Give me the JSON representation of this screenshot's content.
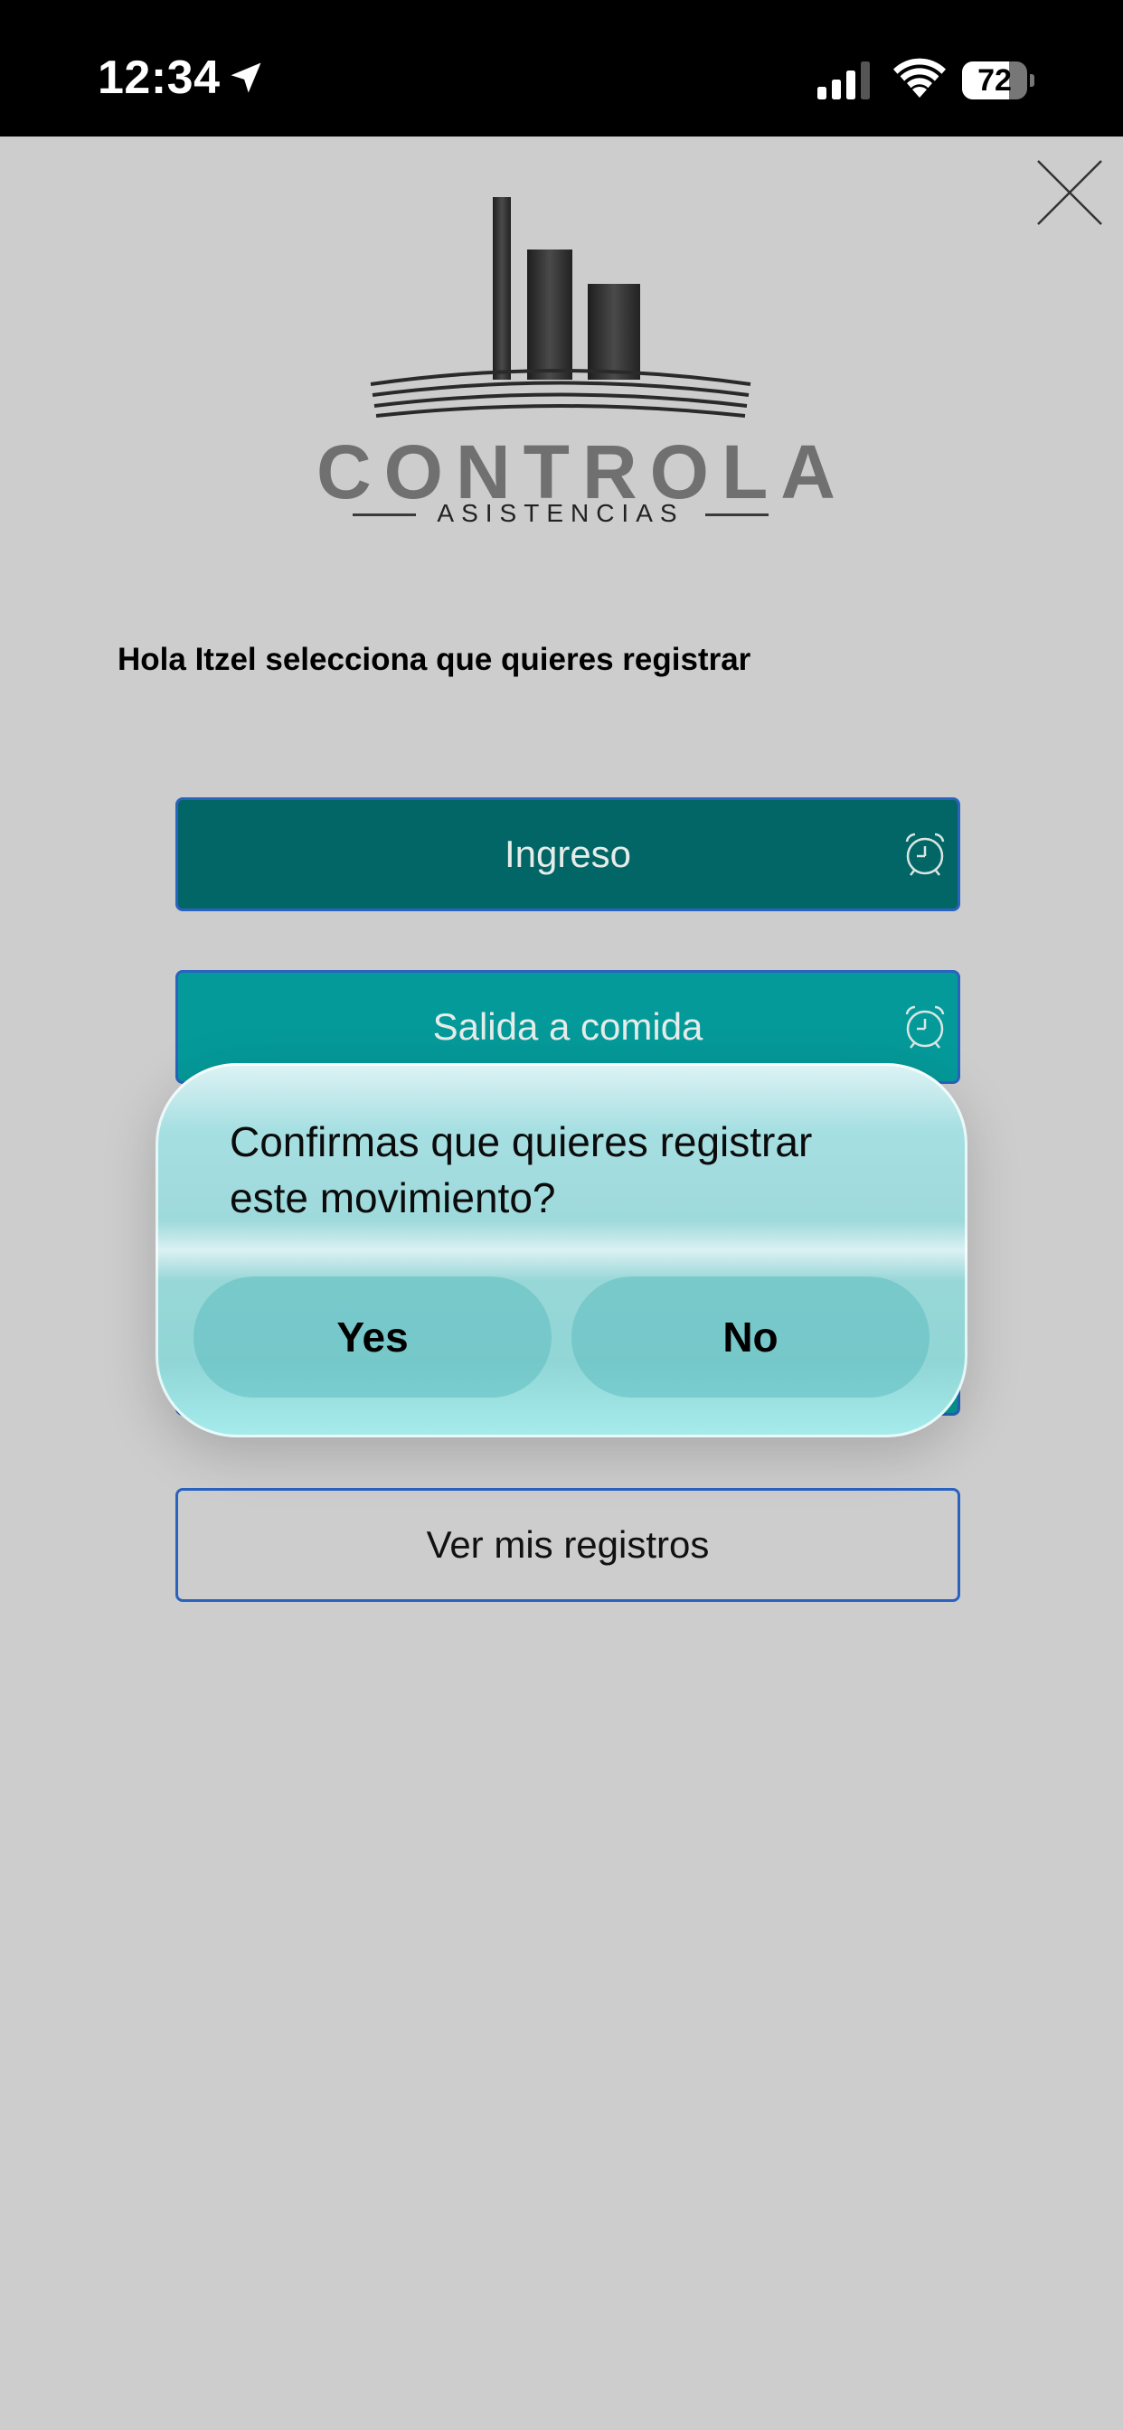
{
  "status_bar": {
    "time": "12:34",
    "battery": "72",
    "battery_level": 0.72,
    "icons": [
      "location-arrow-icon",
      "signal-icon",
      "wifi-icon",
      "battery-icon"
    ]
  },
  "logo": {
    "word": "CONTROLA",
    "sub": "ASISTENCIAS"
  },
  "greeting": "Hola Itzel selecciona que quieres registrar",
  "buttons": {
    "ingreso": "Ingreso",
    "salida": "Salida a comida",
    "ver": "Ver mis registros"
  },
  "dialog": {
    "message": "Confirmas que quieres registrar este movimiento?",
    "yes": "Yes",
    "no": "No"
  },
  "colors": {
    "background": "#cdcdcd",
    "ingreso": "#026666",
    "salida": "#059a9a",
    "border": "#2a62c0"
  }
}
